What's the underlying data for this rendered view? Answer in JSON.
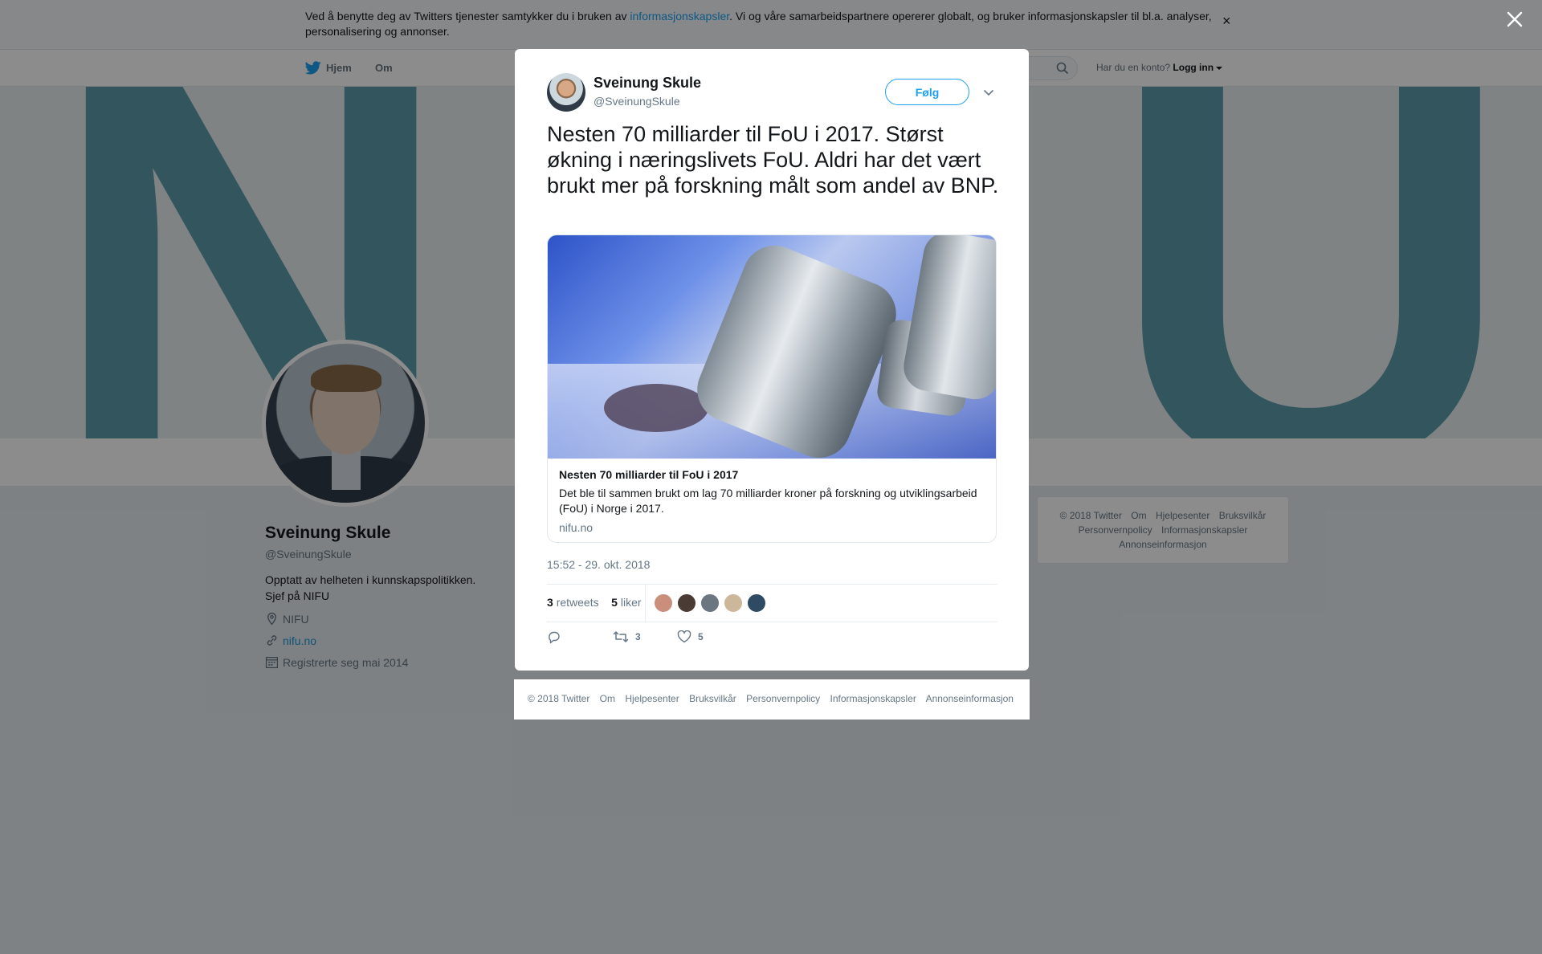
{
  "cookie_bar": {
    "text_before": "Ved å benytte deg av Twitters tjenester samtykker du i bruken av ",
    "link": "informasjonskapsler",
    "text_after": ". Vi og våre samarbeidspartnere opererer globalt, og bruker informasjonskapsler til bl.a. analyser, personalisering og annonser.",
    "close": "×"
  },
  "nav": {
    "home": "Hjem",
    "about": "Om",
    "account_prompt": "Har du en konto?",
    "login": "Logg inn"
  },
  "profile": {
    "name": "Sveinung Skule",
    "handle": "@SveinungSkule",
    "bio_line1": "Opptatt av helheten i kunnskapspolitikken.",
    "bio_line2": "Sjef på NIFU",
    "location": "NIFU",
    "website": "nifu.no",
    "joined": "Registrerte seg mai 2014"
  },
  "side_footer": {
    "items": [
      "© 2018 Twitter",
      "Om",
      "Hjelpesenter",
      "Bruksvilkår",
      "Personvernpolicy",
      "Informasjonskapsler",
      "Annonseinformasjon"
    ]
  },
  "tweet": {
    "author_name": "Sveinung Skule",
    "author_handle": "@SveinungSkule",
    "follow_label": "Følg",
    "text": "Nesten 70 milliarder til FoU i 2017. Størst økning i næringslivets FoU. Aldri har det vært brukt mer på forskning målt som andel av BNP.",
    "card_title": "Nesten 70 milliarder til FoU i 2017",
    "card_description": "Det ble til sammen brukt om lag 70 milliarder kroner på forskning og utviklingsarbeid (FoU) i Norge i 2017.",
    "card_domain": "nifu.no",
    "timestamp": "15:52 - 29. okt. 2018",
    "retweet_count": "3",
    "retweet_label": "retweets",
    "like_count": "5",
    "like_label": "liker",
    "action_retweets": "3",
    "action_likes": "5",
    "liker_avatar_colors": [
      "#e9d3c2",
      "#c98f7c",
      "#4a3b35",
      "#6c7680",
      "#cdb79a",
      "#2f4a63"
    ]
  },
  "modal_footer": {
    "items": [
      "© 2018 Twitter",
      "Om",
      "Hjelpesenter",
      "Bruksvilkår",
      "Personvernpolicy",
      "Informasjonskapsler",
      "Annonseinformasjon"
    ]
  },
  "colors": {
    "accent": "#1da1f2",
    "banner_letters": "#5c9bab"
  }
}
